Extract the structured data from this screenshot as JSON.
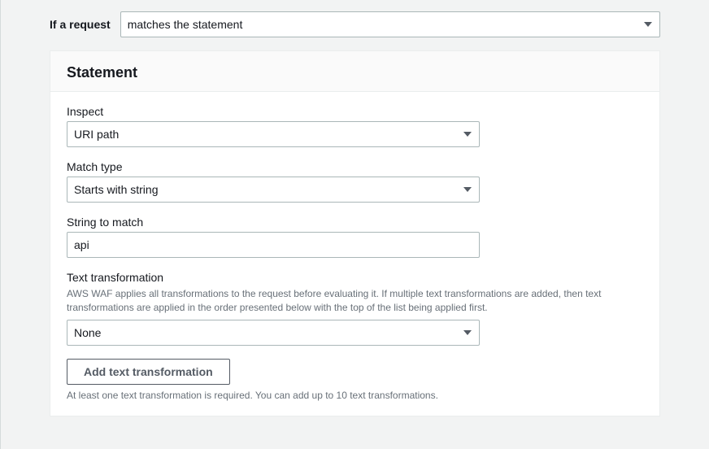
{
  "condition": {
    "label": "If a request",
    "value": "matches the statement"
  },
  "panel": {
    "title": "Statement",
    "inspect": {
      "label": "Inspect",
      "value": "URI path"
    },
    "matchType": {
      "label": "Match type",
      "value": "Starts with string"
    },
    "stringToMatch": {
      "label": "String to match",
      "value": "api"
    },
    "textTransformation": {
      "label": "Text transformation",
      "description": "AWS WAF applies all transformations to the request before evaluating it. If multiple text transformations are added, then text transformations are applied in the order presented below with the top of the list being applied first.",
      "value": "None"
    },
    "addButton": "Add text transformation",
    "addHint": "At least one text transformation is required. You can add up to 10 text transformations."
  }
}
